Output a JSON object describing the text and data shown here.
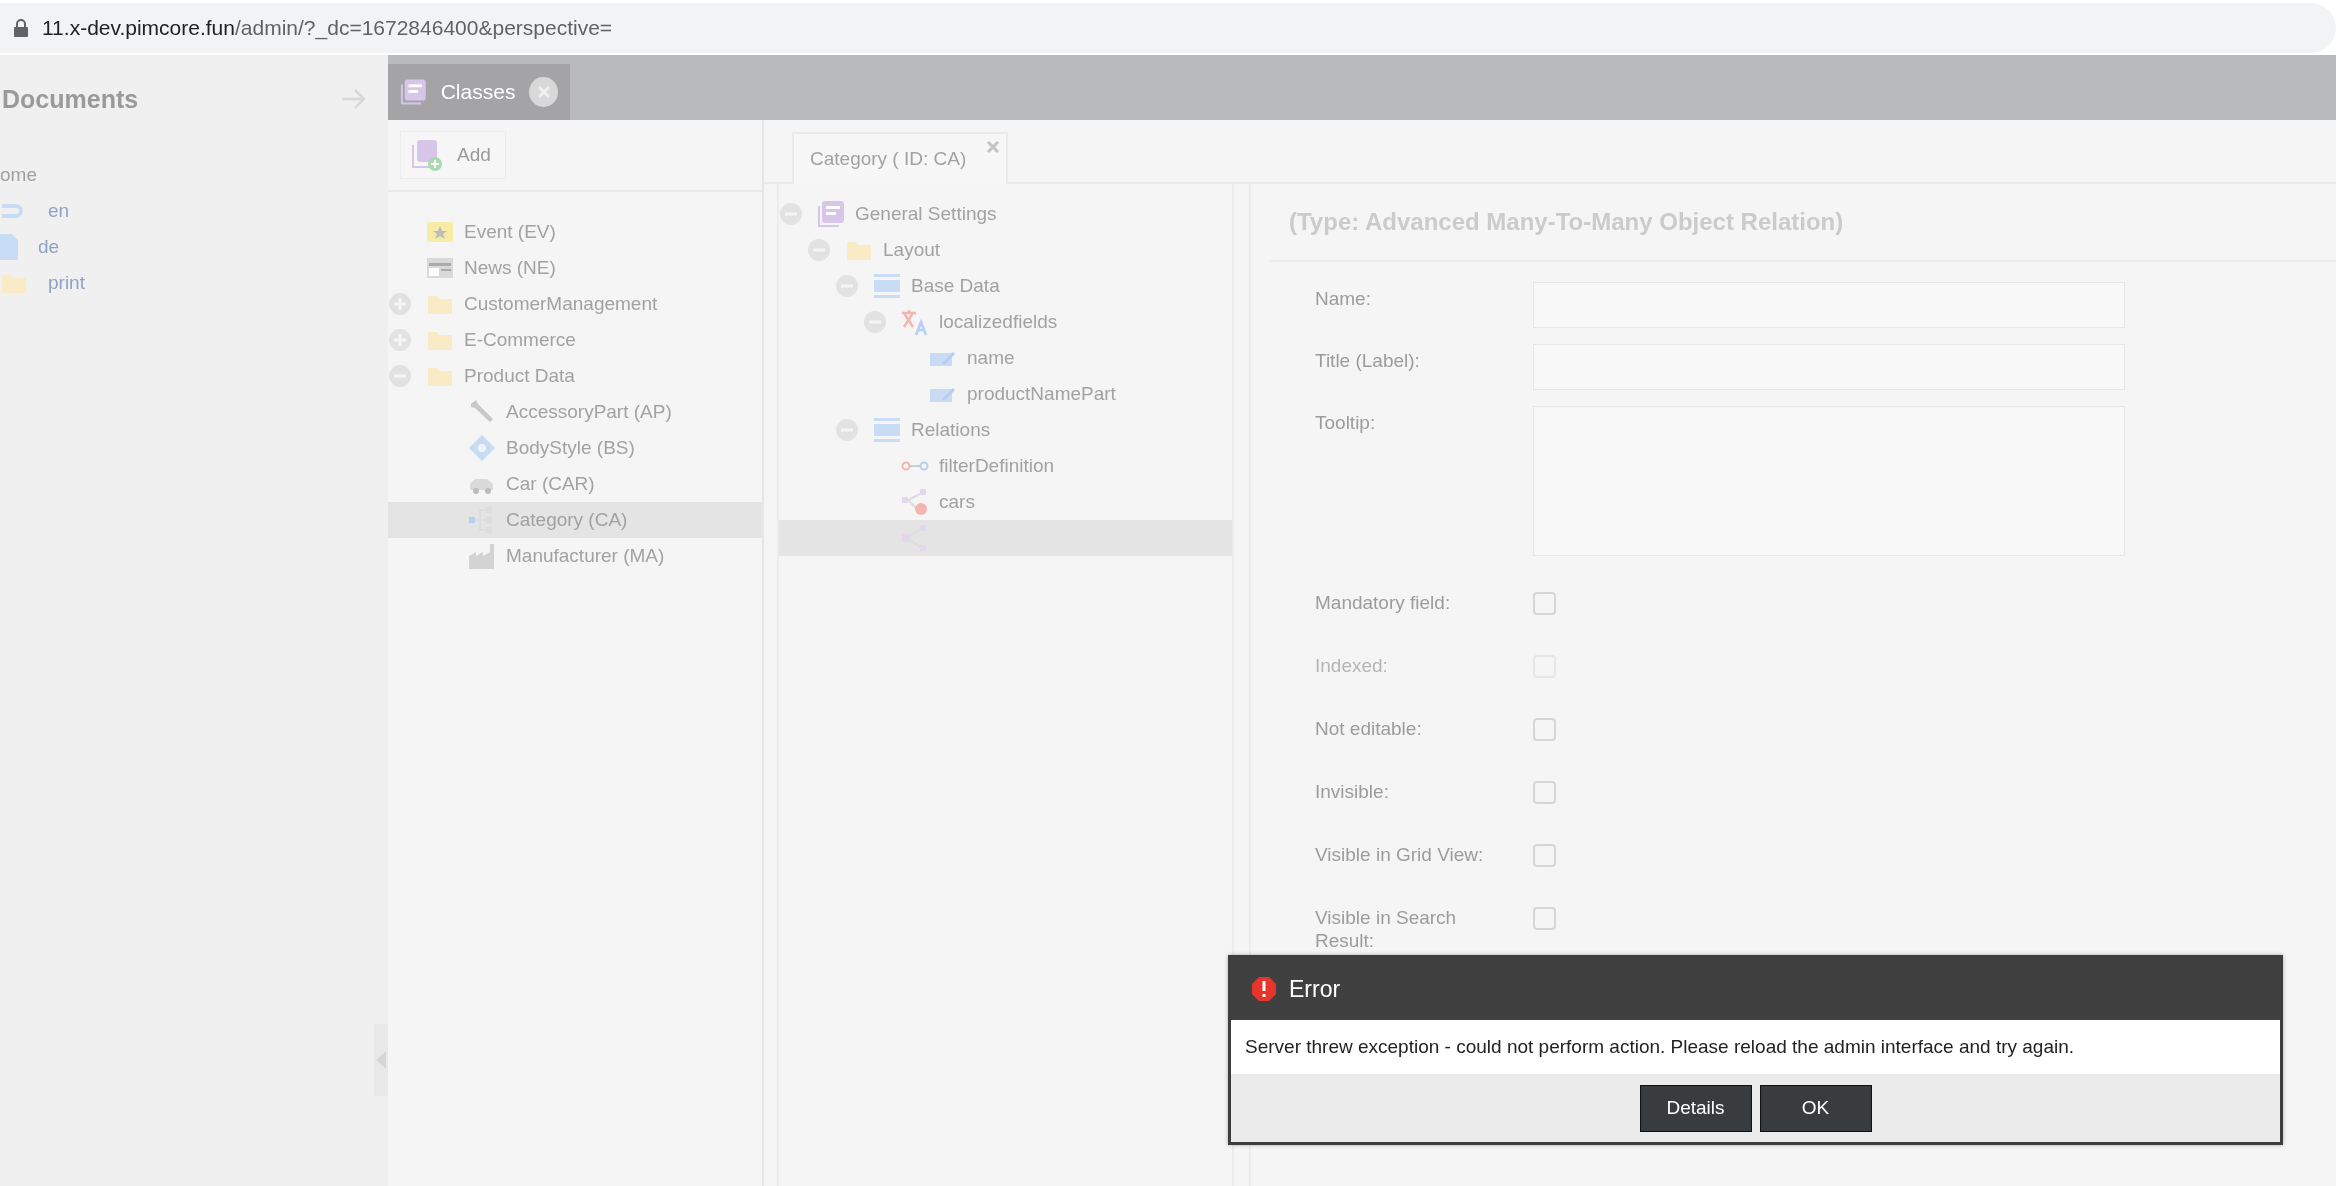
{
  "browser": {
    "host": "11.x-dev.pimcore.fun",
    "path": "/admin/?_dc=1672846400&perspective="
  },
  "documents": {
    "title": "Documents",
    "tree": [
      {
        "label": "ome",
        "children": [
          {
            "label": "en",
            "kind": "link"
          },
          {
            "label": "de",
            "kind": "page"
          },
          {
            "label": "print",
            "kind": "folder"
          }
        ]
      }
    ]
  },
  "main_tabs": [
    {
      "label": "Classes",
      "selected": true
    }
  ],
  "classes": {
    "add_button": "Add",
    "tree": [
      {
        "label": "Event (EV)",
        "kind": "event",
        "selected": false
      },
      {
        "label": "News (NE)",
        "kind": "news",
        "selected": false
      },
      {
        "label": "CustomerManagement",
        "kind": "folder",
        "expanded": false,
        "selected": false
      },
      {
        "label": "E-Commerce",
        "kind": "folder",
        "expanded": false,
        "selected": false
      },
      {
        "label": "Product Data",
        "kind": "folder",
        "expanded": true,
        "selected": false,
        "children": [
          {
            "label": "AccessoryPart (AP)",
            "kind": "wrench",
            "selected": false
          },
          {
            "label": "BodyStyle (BS)",
            "kind": "diamond",
            "selected": false
          },
          {
            "label": "Car (CAR)",
            "kind": "car",
            "selected": false
          },
          {
            "label": "Category (CA)",
            "kind": "hierarchy",
            "selected": true
          },
          {
            "label": "Manufacturer (MA)",
            "kind": "factory",
            "selected": false
          }
        ]
      }
    ]
  },
  "editor_tabs": [
    {
      "label": "Category ( ID: CA)",
      "selected": true
    }
  ],
  "layout_tree": [
    {
      "label": "General Settings",
      "kind": "class",
      "expanded": true,
      "selected": false,
      "children": [
        {
          "label": "Layout",
          "kind": "folder",
          "expanded": true,
          "selected": false,
          "children": [
            {
              "label": "Base Data",
              "kind": "panel",
              "expanded": true,
              "selected": false,
              "children": [
                {
                  "label": "localizedfields",
                  "kind": "localized",
                  "expanded": true,
                  "selected": false,
                  "children": [
                    {
                      "label": "name",
                      "kind": "input",
                      "selected": false
                    },
                    {
                      "label": "productNamePart",
                      "kind": "input",
                      "selected": false
                    }
                  ]
                }
              ]
            },
            {
              "label": "Relations",
              "kind": "panel",
              "expanded": true,
              "selected": false,
              "children": [
                {
                  "label": "filterDefinition",
                  "kind": "relation",
                  "selected": false
                },
                {
                  "label": "cars",
                  "kind": "reverse",
                  "selected": false
                },
                {
                  "kind": "many",
                  "selected": true
                }
              ]
            }
          ]
        }
      ]
    }
  ],
  "form": {
    "title": "(Type: Advanced Many-To-Many Object Relation)",
    "fields": [
      {
        "label": "Name:",
        "kind": "text"
      },
      {
        "label": "Title (Label):",
        "kind": "text"
      },
      {
        "label": "Tooltip:",
        "kind": "textarea"
      }
    ],
    "checkboxes": [
      {
        "label": "Mandatory field:",
        "checked": false,
        "disabled": false
      },
      {
        "label": "Indexed:",
        "checked": false,
        "disabled": true
      },
      {
        "label": "Not editable:",
        "checked": false,
        "disabled": false
      },
      {
        "label": "Invisible:",
        "checked": false,
        "disabled": false
      },
      {
        "label": "Visible in Grid View:",
        "checked": false,
        "disabled": false
      },
      {
        "label": "Visible in Search Result:",
        "checked": false,
        "disabled": false
      }
    ]
  },
  "dialog": {
    "title": "Error",
    "message": "Server threw exception - could not perform action. Please reload the admin interface and try again.",
    "buttons": [
      "Details",
      "OK"
    ]
  }
}
